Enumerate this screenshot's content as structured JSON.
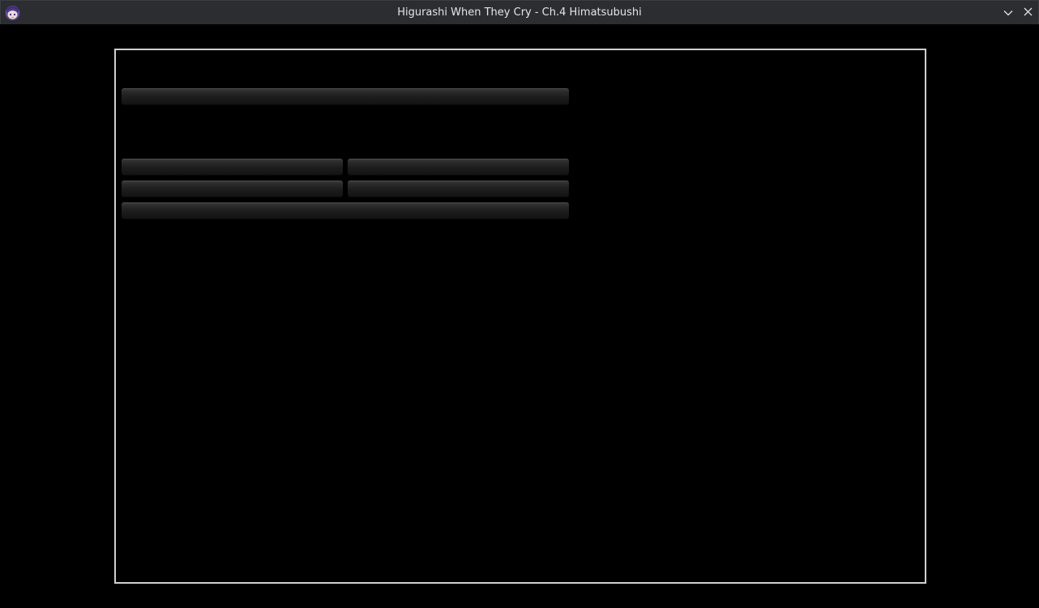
{
  "window": {
    "title": "Higurashi When They Cry - Ch.4 Himatsubushi",
    "app_icon": "rika-avatar-icon",
    "controls": {
      "minimize_icon": "chevron-down-icon",
      "close_icon": "close-icon"
    }
  },
  "menu": {
    "primary_bar": "",
    "option_bars": [
      "",
      "",
      "",
      ""
    ],
    "footer_bar": ""
  },
  "colors": {
    "titlebar": "#2b2d30",
    "frame_border": "#cfcfcf",
    "background": "#000000"
  }
}
